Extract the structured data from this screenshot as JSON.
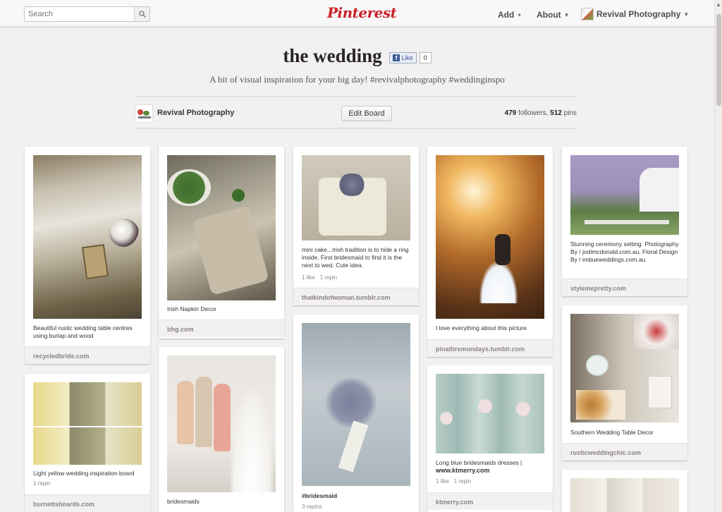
{
  "header": {
    "search_placeholder": "Search",
    "logo": "Pinterest",
    "add_label": "Add",
    "about_label": "About",
    "user_label": "Revival Photography"
  },
  "board": {
    "title": "the wedding",
    "fb_like": "Like",
    "fb_count": "0",
    "description": "A bit of visual inspiration for your big day! #revivalphotography #weddinginspo",
    "owner": "Revival Photography",
    "edit_label": "Edit Board",
    "followers_count": "479",
    "followers_label": "followers,",
    "pins_count": "512",
    "pins_label": "pins"
  },
  "pins": {
    "p1": {
      "desc": "Beautiful rustic wedding table centres using burlap and wood",
      "src": "recycledbride.com"
    },
    "p2": {
      "desc": "Light yellow wedding inspiration board",
      "repins": "1 repin",
      "src": "burnettsboards.com"
    },
    "p3": {
      "desc": "Irish Napkin Decor",
      "src": "bhg.com"
    },
    "p4": {
      "desc": "bridesmaids"
    },
    "p5": {
      "desc": "mini cake...Irish tradition is to hide a ring inside. First bridesmaid to find it is the next to wed. Cute idea.",
      "likes": "1 like",
      "repins": "1 repin",
      "src": "thatkindofwoman.tumblr.com"
    },
    "p6": {
      "desc": "#bridesmaid",
      "repins": "3 repins"
    },
    "p7": {
      "desc": "I love everything about this picture",
      "src": "pinattiremondays.tumblr.com"
    },
    "p8": {
      "desc": "Long blue bridesmaids dresses |",
      "desc2": "www.ktmerry.com",
      "likes": "1 like",
      "repins": "1 repin",
      "src": "ktmerry.com"
    },
    "p9": {
      "desc": "Stunning ceremony setting. Photography By / jodimcdonald.com.au, Floral Design By / imbueweddings.com.au",
      "src": "stylemepretty.com"
    },
    "p10": {
      "desc": "Southern Wedding Table Decor",
      "src": "rusticweddingchic.com"
    }
  },
  "colors": {
    "brand": "#c8232c",
    "background": "#f2f0f0",
    "card": "#ffffff"
  }
}
